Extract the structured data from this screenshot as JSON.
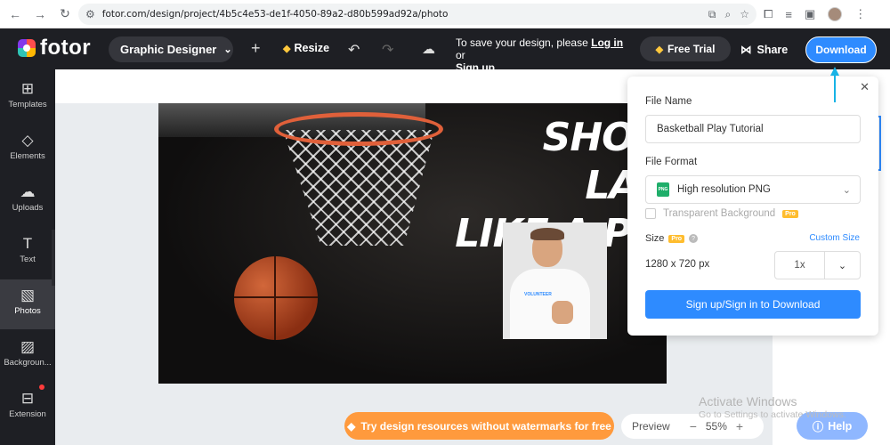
{
  "browser": {
    "url": "fotor.com/design/project/4b5c4e53-de1f-4050-89a2-d80b599ad92a/photo"
  },
  "topbar": {
    "logo_text": "fotor",
    "role": "Graphic Designer",
    "resize_label": "Resize",
    "save_note_prefix": "To save your design, please",
    "login_link": "Log in",
    "or_text": "or",
    "signup_link": "Sign up",
    "free_trial_label": "Free Trial",
    "share_label": "Share",
    "download_label": "Download"
  },
  "sidebar": {
    "items": [
      {
        "label": "Templates",
        "icon": "templates-icon"
      },
      {
        "label": "Elements",
        "icon": "elements-icon"
      },
      {
        "label": "Uploads",
        "icon": "uploads-icon"
      },
      {
        "label": "Text",
        "icon": "text-icon"
      },
      {
        "label": "Photos",
        "icon": "photos-icon"
      },
      {
        "label": "Backgroun...",
        "icon": "background-icon"
      },
      {
        "label": "Extension",
        "icon": "extension-icon"
      }
    ]
  },
  "design": {
    "headline_line1": "SHOOT LAYU",
    "headline_line2": "LIKE A PRO",
    "shirt_text": "VOLUNTEER"
  },
  "bottom": {
    "promo_label": "Try design resources without watermarks for free",
    "preview_label": "Preview",
    "zoom_value": "55%",
    "help_label": "Help"
  },
  "watermark": {
    "title": "Activate Windows",
    "sub": "Go to Settings to activate Windows."
  },
  "download_dialog": {
    "file_name_label": "File Name",
    "file_name_value": "Basketball Play Tutorial",
    "file_format_label": "File Format",
    "file_format_value": "High resolution PNG",
    "png_badge": "PNG",
    "transparent_label": "Transparent Background",
    "pro_badge": "Pro",
    "size_label": "Size",
    "custom_size_label": "Custom Size",
    "dimensions": "1280 x 720 px",
    "scale_value": "1x",
    "signin_label": "Sign up/Sign in to Download"
  },
  "colors": {
    "accent": "#2e8bff",
    "topbar_bg": "#1e1f24",
    "promo_orange": "#ff9a3d",
    "arrow_cyan": "#17b3e6"
  }
}
